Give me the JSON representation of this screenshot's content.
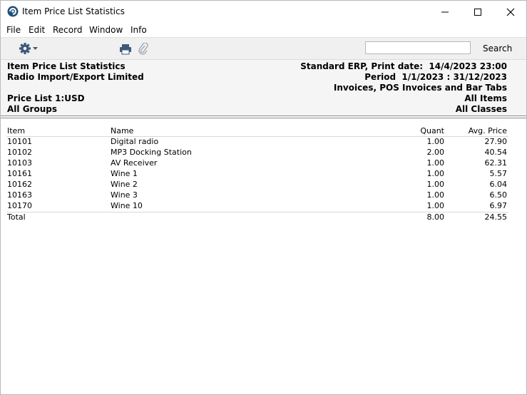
{
  "window": {
    "title": "Item Price List Statistics"
  },
  "menu": [
    "File",
    "Edit",
    "Record",
    "Window",
    "Info"
  ],
  "toolbar": {
    "search_value": "",
    "search_label": "Search"
  },
  "header": {
    "left": [
      "Item Price List Statistics",
      "Radio Import/Export Limited",
      "",
      "Price List 1:USD",
      "All Groups"
    ],
    "right": [
      "Standard ERP, Print date:  14/4/2023 23:00",
      "Period  1/1/2023 : 31/12/2023",
      "Invoices, POS Invoices and Bar Tabs",
      "All Items",
      "All Classes"
    ]
  },
  "table": {
    "columns": [
      "Item",
      "Name",
      "Quant",
      "Avg. Price"
    ],
    "rows": [
      [
        "10101",
        "Digital radio",
        "1.00",
        "27.90"
      ],
      [
        "10102",
        "MP3 Docking Station",
        "2.00",
        "40.54"
      ],
      [
        "10103",
        "AV Receiver",
        "1.00",
        "62.31"
      ],
      [
        "10161",
        "Wine 1",
        "1.00",
        "5.57"
      ],
      [
        "10162",
        "Wine 2",
        "1.00",
        "6.04"
      ],
      [
        "10163",
        "Wine 3",
        "1.00",
        "6.50"
      ],
      [
        "10170",
        "Wine 10",
        "1.00",
        "6.97"
      ]
    ],
    "total": [
      "Total",
      "",
      "8.00",
      "24.55"
    ]
  }
}
